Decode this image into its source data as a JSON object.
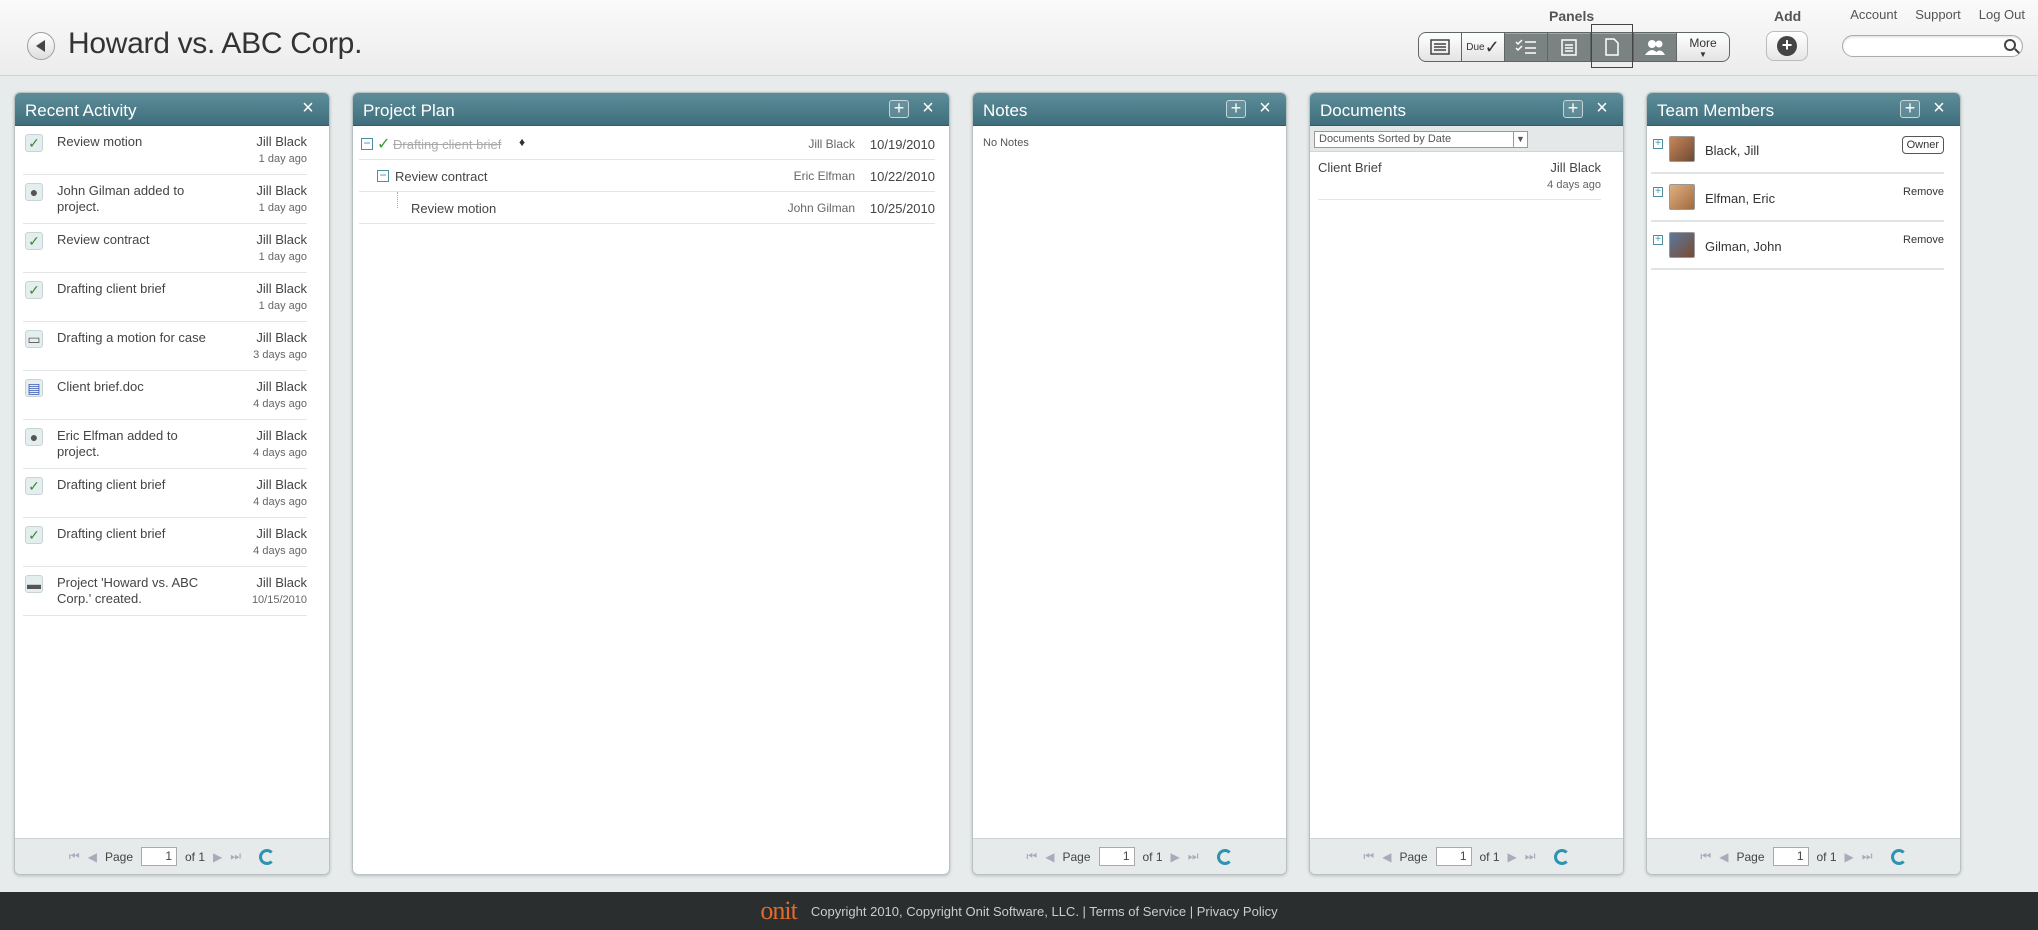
{
  "header": {
    "title": "Howard vs. ABC Corp.",
    "panels_label": "Panels",
    "panel_buttons": [
      "list-icon",
      "Due",
      "checklist-icon",
      "clipboard-icon",
      "document-icon",
      "people-icon"
    ],
    "more_label": "More",
    "add_label": "Add",
    "links": [
      "Account",
      "Support",
      "Log Out"
    ],
    "search_placeholder": ""
  },
  "recent_activity": {
    "title": "Recent Activity",
    "items": [
      {
        "icon": "check",
        "text": "Review motion",
        "user": "Jill Black",
        "time": "1 day ago"
      },
      {
        "icon": "person",
        "text": "John Gilman added to project.",
        "user": "Jill Black",
        "time": "1 day ago"
      },
      {
        "icon": "check",
        "text": "Review contract",
        "user": "Jill Black",
        "time": "1 day ago"
      },
      {
        "icon": "check",
        "text": "Drafting client brief",
        "user": "Jill Black",
        "time": "1 day ago"
      },
      {
        "icon": "comment",
        "text": "Drafting a motion for case",
        "user": "Jill Black",
        "time": "3 days ago"
      },
      {
        "icon": "doc",
        "text": "Client brief.doc",
        "user": "Jill Black",
        "time": "4 days ago"
      },
      {
        "icon": "person",
        "text": "Eric Elfman added to project.",
        "user": "Jill Black",
        "time": "4 days ago"
      },
      {
        "icon": "check",
        "text": "Drafting client brief",
        "user": "Jill Black",
        "time": "4 days ago"
      },
      {
        "icon": "check",
        "text": "Drafting client brief",
        "user": "Jill Black",
        "time": "4 days ago"
      },
      {
        "icon": "folder",
        "text": "Project 'Howard vs. ABC Corp.' created.",
        "user": "Jill Black",
        "time": "10/15/2010"
      }
    ],
    "pager": {
      "page_label": "Page",
      "page": "1",
      "of_label": "of 1"
    }
  },
  "project_plan": {
    "title": "Project Plan",
    "rows": [
      {
        "task": "Drafting client brief",
        "owner": "Jill Black",
        "date": "10/19/2010"
      },
      {
        "task": "Review contract",
        "owner": "Eric Elfman",
        "date": "10/22/2010"
      },
      {
        "task": "Review motion",
        "owner": "John Gilman",
        "date": "10/25/2010"
      }
    ]
  },
  "notes": {
    "title": "Notes",
    "empty": "No Notes",
    "pager": {
      "page_label": "Page",
      "page": "1",
      "of_label": "of 1"
    }
  },
  "documents": {
    "title": "Documents",
    "sort_label": "Documents Sorted by Date",
    "rows": [
      {
        "name": "Client Brief",
        "user": "Jill Black",
        "time": "4 days ago"
      }
    ],
    "pager": {
      "page_label": "Page",
      "page": "1",
      "of_label": "of 1"
    }
  },
  "team_members": {
    "title": "Team Members",
    "members": [
      {
        "name": "Black, Jill",
        "action": "Owner"
      },
      {
        "name": "Elfman, Eric",
        "action": "Remove"
      },
      {
        "name": "Gilman, John",
        "action": "Remove"
      }
    ],
    "pager": {
      "page_label": "Page",
      "page": "1",
      "of_label": "of 1"
    }
  },
  "footer": {
    "logo": "onit",
    "copyright": "Copyright 2010, Copyright Onit Software, LLC. | Terms of Service | Privacy Policy"
  }
}
